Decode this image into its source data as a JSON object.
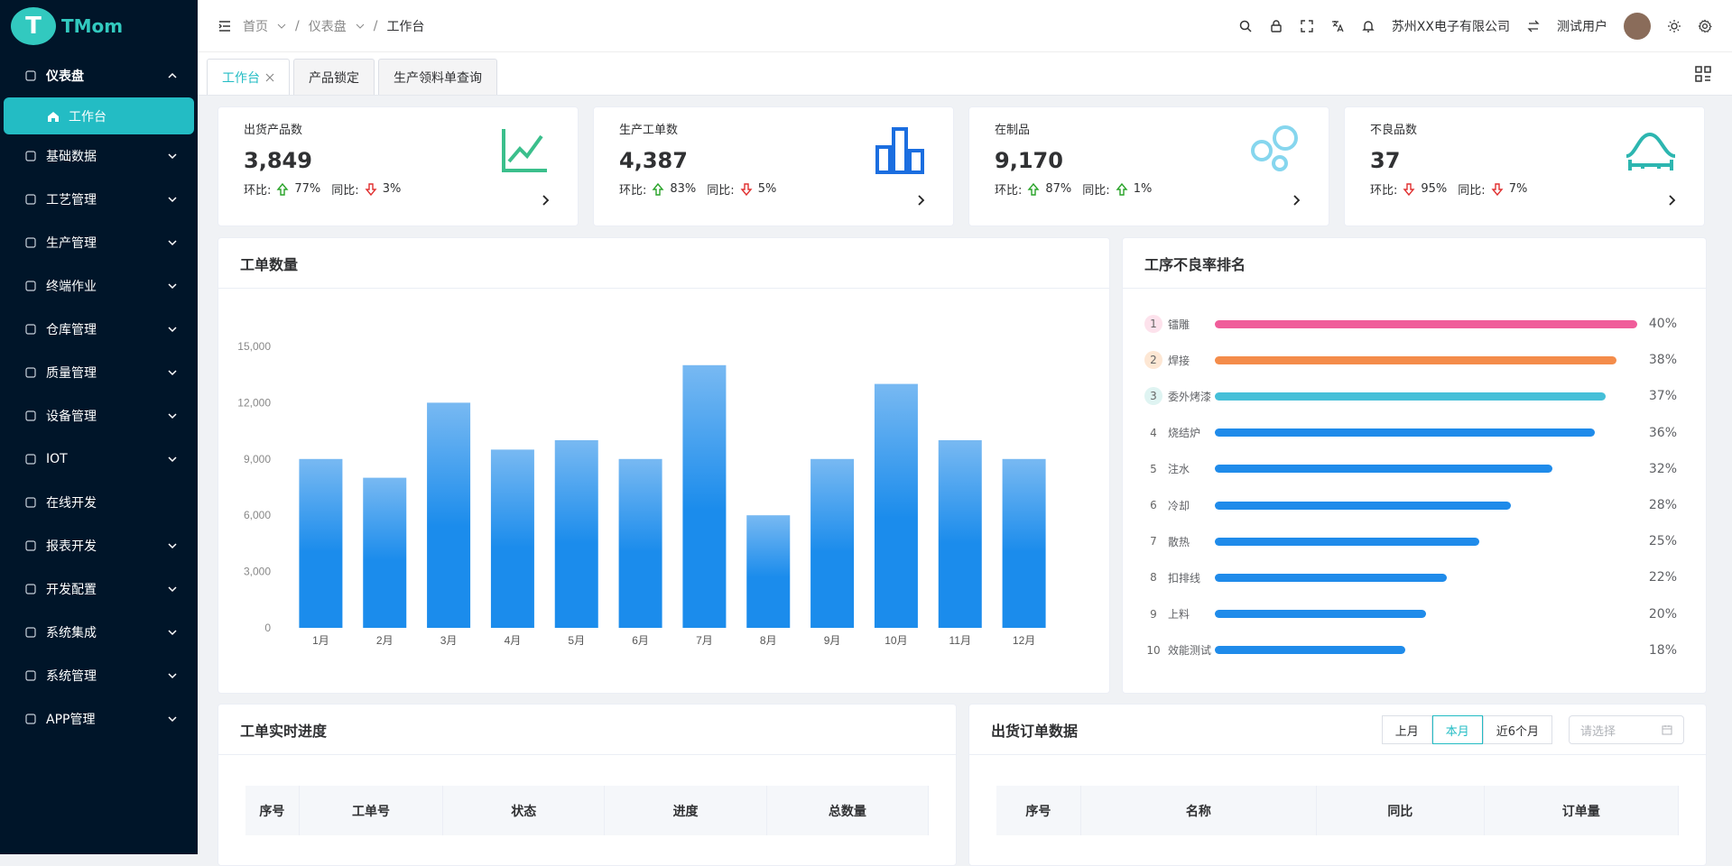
{
  "app": {
    "logo_letter": "T",
    "logo_text": "TMom"
  },
  "sidebar": {
    "items": [
      {
        "label": "仪表盘",
        "icon": "dashboard-icon"
      },
      {
        "label": "工作台",
        "icon": "home-icon"
      },
      {
        "label": "基础数据",
        "icon": "file-icon"
      },
      {
        "label": "工艺管理",
        "icon": "process-icon"
      },
      {
        "label": "生产管理",
        "icon": "production-icon"
      },
      {
        "label": "终端作业",
        "icon": "terminal-icon"
      },
      {
        "label": "仓库管理",
        "icon": "warehouse-icon"
      },
      {
        "label": "质量管理",
        "icon": "quality-icon"
      },
      {
        "label": "设备管理",
        "icon": "device-icon"
      },
      {
        "label": "IOT",
        "icon": "iot-icon"
      },
      {
        "label": "在线开发",
        "icon": "dev-icon"
      },
      {
        "label": "报表开发",
        "icon": "report-icon"
      },
      {
        "label": "开发配置",
        "icon": "config-icon"
      },
      {
        "label": "系统集成",
        "icon": "integration-icon"
      },
      {
        "label": "系统管理",
        "icon": "settings-icon"
      },
      {
        "label": "APP管理",
        "icon": "app-icon"
      }
    ]
  },
  "header": {
    "breadcrumb": [
      "首页",
      "仪表盘",
      "工作台"
    ],
    "company": "苏州XX电子有限公司",
    "user": "测试用户"
  },
  "tabs": [
    {
      "label": "工作台"
    },
    {
      "label": "产品锁定"
    },
    {
      "label": "生产领料单查询"
    }
  ],
  "stats": [
    {
      "label": "出货产品数",
      "value": "3,849",
      "hb_label": "环比:",
      "hb": "77%",
      "tb_label": "同比:",
      "tb": "3%",
      "hb_dir": "up",
      "tb_dir": "down",
      "icon": "line-chart-icon",
      "color": "#3bbf8c"
    },
    {
      "label": "生产工单数",
      "value": "4,387",
      "hb_label": "环比:",
      "hb": "83%",
      "tb_label": "同比:",
      "tb": "5%",
      "hb_dir": "up",
      "tb_dir": "down",
      "icon": "bar-chart-icon",
      "color": "#1b6ee0"
    },
    {
      "label": "在制品",
      "value": "9,170",
      "hb_label": "环比:",
      "hb": "87%",
      "tb_label": "同比:",
      "tb": "1%",
      "hb_dir": "up",
      "tb_dir": "up",
      "icon": "bubbles-icon",
      "color": "#86d6ee"
    },
    {
      "label": "不良品数",
      "value": "37",
      "hb_label": "环比:",
      "hb": "95%",
      "tb_label": "同比:",
      "tb": "7%",
      "hb_dir": "down",
      "tb_dir": "down",
      "icon": "bell-curve-icon",
      "color": "#2db6b0"
    }
  ],
  "work_order": {
    "title": "工单数量"
  },
  "chart_data": {
    "type": "bar",
    "categories": [
      "1月",
      "2月",
      "3月",
      "4月",
      "5月",
      "6月",
      "7月",
      "8月",
      "9月",
      "10月",
      "11月",
      "12月"
    ],
    "values": [
      9000,
      8000,
      12000,
      9500,
      10000,
      9000,
      14000,
      6000,
      9000,
      13000,
      10000,
      9000
    ],
    "ylim": [
      0,
      15000
    ],
    "yticks": [
      "0",
      "3,000",
      "6,000",
      "9,000",
      "12,000",
      "15,000"
    ],
    "ytick_values": [
      0,
      3000,
      6000,
      9000,
      12000,
      15000
    ],
    "grid": false
  },
  "ranking": {
    "title": "工序不良率排名",
    "items": [
      {
        "rank": "1",
        "name": "镭雕",
        "pct": "40%",
        "value": 40,
        "color": "#f05d9a",
        "badge": "#fde2ec"
      },
      {
        "rank": "2",
        "name": "焊接",
        "pct": "38%",
        "value": 38,
        "color": "#f48c4a",
        "badge": "#fde7d4"
      },
      {
        "rank": "3",
        "name": "委外烤漆",
        "pct": "37%",
        "value": 37,
        "color": "#45bfd8",
        "badge": "#dff4f2"
      },
      {
        "rank": "4",
        "name": "烧结炉",
        "pct": "36%",
        "value": 36,
        "color": "#1f8bea",
        "badge": ""
      },
      {
        "rank": "5",
        "name": "注水",
        "pct": "32%",
        "value": 32,
        "color": "#1f8bea",
        "badge": ""
      },
      {
        "rank": "6",
        "name": "冷却",
        "pct": "28%",
        "value": 28,
        "color": "#1f8bea",
        "badge": ""
      },
      {
        "rank": "7",
        "name": "散热",
        "pct": "25%",
        "value": 25,
        "color": "#1f8bea",
        "badge": ""
      },
      {
        "rank": "8",
        "name": "扣排线",
        "pct": "22%",
        "value": 22,
        "color": "#1f8bea",
        "badge": ""
      },
      {
        "rank": "9",
        "name": "上料",
        "pct": "20%",
        "value": 20,
        "color": "#1f8bea",
        "badge": ""
      },
      {
        "rank": "10",
        "name": "效能测试",
        "pct": "18%",
        "value": 18,
        "color": "#1f8bea",
        "badge": ""
      }
    ]
  },
  "progress": {
    "title": "工单实时进度",
    "columns": [
      "序号",
      "工单号",
      "状态",
      "进度",
      "总数量"
    ]
  },
  "shipping": {
    "title": "出货订单数据",
    "buttons": [
      "上月",
      "本月",
      "近6个月"
    ],
    "active": "本月",
    "date_placeholder": "请选择",
    "columns": [
      "序号",
      "名称",
      "同比",
      "订单量"
    ]
  }
}
